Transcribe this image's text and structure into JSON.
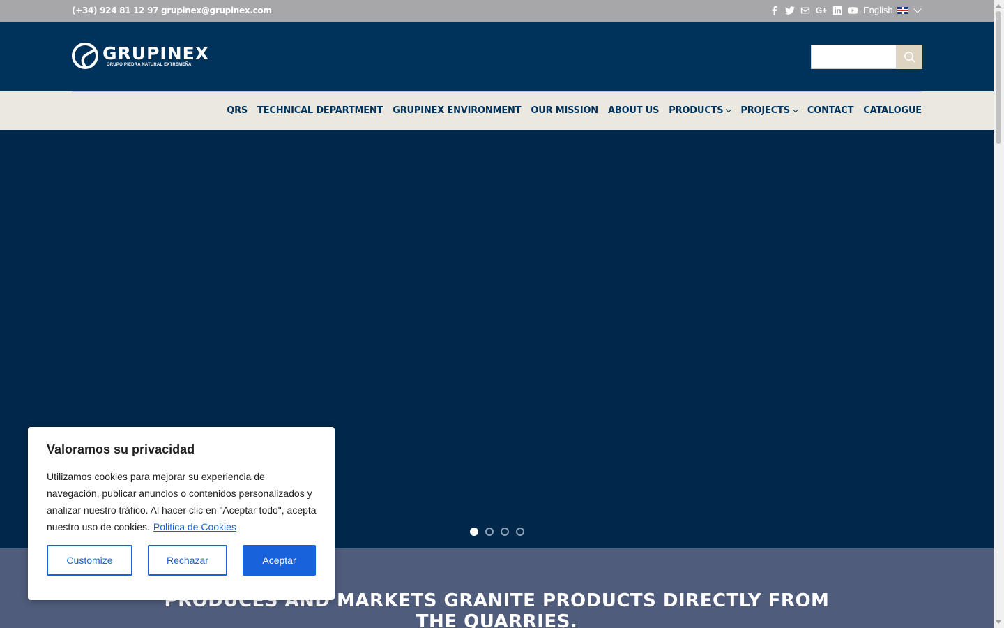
{
  "topbar": {
    "contact": "(+34) 924 81 12 97 grupinex@grupinex.com",
    "language": "English"
  },
  "social_icons": [
    "facebook-icon",
    "twitter-icon",
    "email-icon",
    "google-plus-icon",
    "linkedin-icon",
    "youtube-icon"
  ],
  "logo": {
    "name": "GRUPINEX",
    "subtitle": "GRUPO PIEDRA NATURAL EXTREMEÑA"
  },
  "search": {
    "placeholder": ""
  },
  "nav": {
    "items": [
      "QRS",
      "TECHNICAL DEPARTMENT",
      "GRUPINEX ENVIRONMENT",
      "OUR MISSION",
      "ABOUT US",
      "PRODUCTS",
      "PROJECTS",
      "CONTACT",
      "CATALOGUE"
    ]
  },
  "hero": {
    "slide_count": 4,
    "active_slide": 1
  },
  "section": {
    "tagline": "PRODUCES AND MARKETS GRANITE PRODUCTS DIRECTLY FROM THE QUARRIES."
  },
  "cookie": {
    "title": "Valoramos su privacidad",
    "body": "Utilizamos cookies para mejorar su experiencia de navegación, publicar anuncios o contenidos personalizados y analizar nuestro tráfico. Al hacer clic en \"Aceptar todo\", acepta nuestro uso de cookies.",
    "policy_link": "Politica de Cookies",
    "customize_label": "Customize",
    "reject_label": "Rechazar",
    "accept_label": "Aceptar"
  },
  "colors": {
    "topbar": "#a7a7a9",
    "header": "#00335b",
    "nav_bg": "#ebe8e0",
    "hero": "#01284a",
    "section": "#4f5c7b",
    "accent": "#1863dc"
  }
}
